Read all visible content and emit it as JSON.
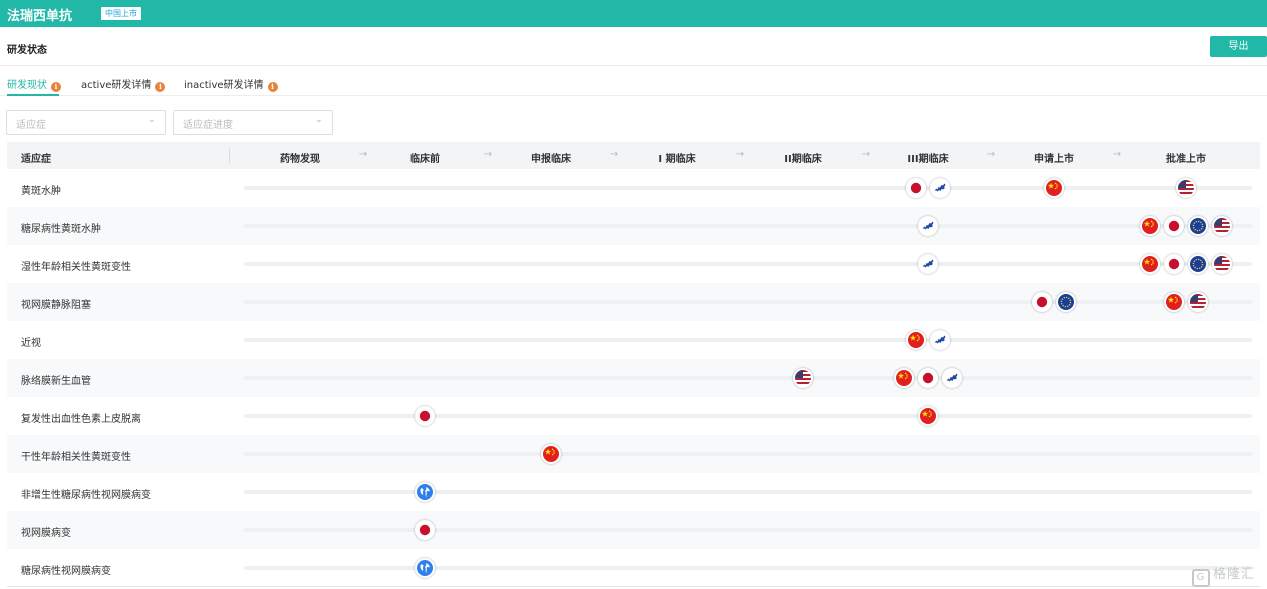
{
  "header": {
    "drug_name": "法瑞西单抗",
    "status_tag": "中国上市"
  },
  "section": {
    "title": "研发状态",
    "export_label": "导出"
  },
  "tabs": [
    {
      "label": "研发现状",
      "active": true
    },
    {
      "label": "active研发详情",
      "active": false
    },
    {
      "label": "inactive研发详情",
      "active": false
    }
  ],
  "filters": [
    {
      "placeholder": "适应症"
    },
    {
      "placeholder": "适应症进度"
    }
  ],
  "table": {
    "first_header": "适应症",
    "phases": [
      "药物发现",
      "临床前",
      "申报临床",
      "I 期临床",
      "II期临床",
      "III期临床",
      "申请上市",
      "批准上市"
    ],
    "rows": [
      {
        "indication": "黄斑水肿",
        "markers": [
          {
            "phase": 5,
            "flags": [
              "japan",
              "europe"
            ]
          },
          {
            "phase": 6,
            "flags": [
              "china"
            ]
          },
          {
            "phase": 7,
            "flags": [
              "usa"
            ]
          }
        ]
      },
      {
        "indication": "糖尿病性黄斑水肿",
        "markers": [
          {
            "phase": 5,
            "flags": [
              "europe"
            ]
          },
          {
            "phase": 7,
            "flags": [
              "china",
              "japan",
              "eu",
              "usa"
            ]
          }
        ]
      },
      {
        "indication": "湿性年龄相关性黄斑变性",
        "markers": [
          {
            "phase": 5,
            "flags": [
              "europe"
            ]
          },
          {
            "phase": 7,
            "flags": [
              "china",
              "japan",
              "eu",
              "usa"
            ]
          }
        ]
      },
      {
        "indication": "视网膜静脉阻塞",
        "markers": [
          {
            "phase": 6,
            "flags": [
              "japan",
              "eu"
            ]
          },
          {
            "phase": 7,
            "flags": [
              "china",
              "usa"
            ]
          }
        ]
      },
      {
        "indication": "近视",
        "markers": [
          {
            "phase": 5,
            "flags": [
              "china",
              "europe"
            ]
          }
        ]
      },
      {
        "indication": "脉络膜新生血管",
        "markers": [
          {
            "phase": 4,
            "flags": [
              "usa"
            ]
          },
          {
            "phase": 5,
            "flags": [
              "china",
              "japan",
              "europe"
            ]
          }
        ]
      },
      {
        "indication": "复发性出血性色素上皮脱离",
        "markers": [
          {
            "phase": 1,
            "flags": [
              "japan"
            ]
          },
          {
            "phase": 5,
            "flags": [
              "china"
            ]
          }
        ]
      },
      {
        "indication": "干性年龄相关性黄斑变性",
        "markers": [
          {
            "phase": 2,
            "flags": [
              "china"
            ]
          }
        ]
      },
      {
        "indication": "非增生性糖尿病性视网膜病变",
        "markers": [
          {
            "phase": 1,
            "flags": [
              "global"
            ]
          }
        ]
      },
      {
        "indication": "视网膜病变",
        "markers": [
          {
            "phase": 1,
            "flags": [
              "japan"
            ]
          }
        ]
      },
      {
        "indication": "糖尿病性视网膜病变",
        "markers": [
          {
            "phase": 1,
            "flags": [
              "global"
            ]
          }
        ]
      }
    ]
  },
  "flag_icons": {
    "china": "china-flag-icon",
    "japan": "japan-flag-icon",
    "usa": "usa-flag-icon",
    "eu": "eu-flag-icon",
    "europe": "europe-map-icon",
    "global": "globe-icon"
  },
  "colors": {
    "accent": "#21b8a7",
    "info": "#e8833a"
  },
  "watermark": "格隆汇"
}
